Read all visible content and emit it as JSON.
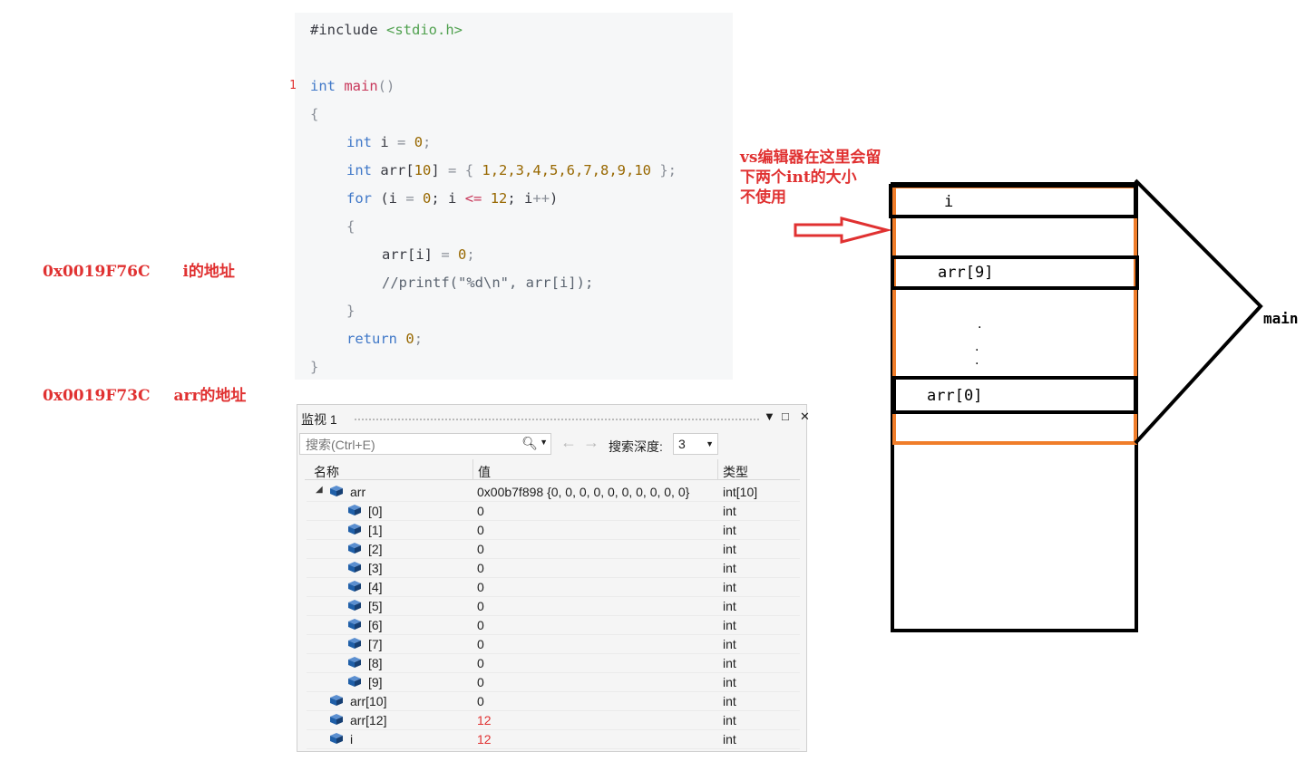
{
  "annotations": {
    "addr_i": {
      "addr": "0x0019F76C",
      "label": "i的地址"
    },
    "addr_arr": {
      "addr": "0x0019F73C",
      "label": "arr的地址"
    },
    "vs_note_lines": [
      "vs编辑器在这里会留",
      "下两个int的大小",
      "不使用"
    ]
  },
  "code": {
    "line_marker": "1",
    "include_directive": "#include",
    "include_header": "<stdio.h>",
    "l_int_main_kw": "int",
    "l_int_main_fn": "main",
    "l_int_main_paren": "()",
    "l_open_brace": "{",
    "l_int_i_kw": "int",
    "l_int_i_rest": " i ",
    "l_eq": "=",
    "l_zero": "0",
    "l_semi": ";",
    "l_arr_kw": "int",
    "l_arr_name": " arr[",
    "l_arr_size": "10",
    "l_arr_close": "] ",
    "l_arr_init_open": "{ ",
    "l_arr_values": "1,2,3,4,5,6,7,8,9,10",
    "l_arr_init_close": " };",
    "l_for_kw": "for",
    "l_for_p1": " (i ",
    "l_for_eq": "=",
    "l_for_zero": "0",
    "l_for_p2": "; i ",
    "l_for_le": "<=",
    "l_for_twelve": "12",
    "l_for_p3": "; i",
    "l_for_inc": "++",
    "l_for_p4": ")",
    "l_inner_open": "{",
    "l_assign_lhs": "arr[i] ",
    "l_assign_eq": "=",
    "l_assign_zero": "0",
    "l_assign_semi": ";",
    "l_comment": "//printf(\"%d\\n\", arr[i]);",
    "l_inner_close": "}",
    "l_return_kw": "return",
    "l_return_zero": "0",
    "l_return_semi": ";",
    "l_close_brace": "}"
  },
  "watch": {
    "title": "监视 1",
    "search_placeholder": "搜索(Ctrl+E)",
    "depth_label": "搜索深度:",
    "depth_value": "3",
    "columns": {
      "name": "名称",
      "value": "值",
      "type": "类型"
    },
    "rows": [
      {
        "name": "arr",
        "value": "0x00b7f898 {0, 0, 0, 0, 0, 0, 0, 0, 0, 0}",
        "type": "int[10]"
      },
      {
        "name": "[0]",
        "value": "0",
        "type": "int"
      },
      {
        "name": "[1]",
        "value": "0",
        "type": "int"
      },
      {
        "name": "[2]",
        "value": "0",
        "type": "int"
      },
      {
        "name": "[3]",
        "value": "0",
        "type": "int"
      },
      {
        "name": "[4]",
        "value": "0",
        "type": "int"
      },
      {
        "name": "[5]",
        "value": "0",
        "type": "int"
      },
      {
        "name": "[6]",
        "value": "0",
        "type": "int"
      },
      {
        "name": "[7]",
        "value": "0",
        "type": "int"
      },
      {
        "name": "[8]",
        "value": "0",
        "type": "int"
      },
      {
        "name": "[9]",
        "value": "0",
        "type": "int"
      },
      {
        "name": "arr[10]",
        "value": "0",
        "type": "int"
      },
      {
        "name": "arr[12]",
        "value": "12",
        "type": "int"
      },
      {
        "name": "i",
        "value": "12",
        "type": "int"
      }
    ]
  },
  "stack": {
    "label_i": "i",
    "label_arr9": "arr[9]",
    "label_arr0": "arr[0]",
    "label_main": "main",
    "dot1": ".",
    "dot2": ".",
    "dot3": "."
  },
  "colors": {
    "annotation": "#e03131",
    "frame_border": "#f07d2a",
    "cube": "#1f5fa8"
  }
}
